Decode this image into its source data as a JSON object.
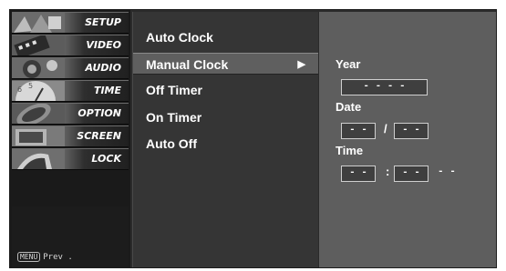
{
  "sidebar": {
    "items": [
      {
        "label": "SETUP"
      },
      {
        "label": "VIDEO"
      },
      {
        "label": "AUDIO"
      },
      {
        "label": "TIME"
      },
      {
        "label": "OPTION"
      },
      {
        "label": "SCREEN"
      },
      {
        "label": "LOCK"
      }
    ],
    "footer": {
      "key_label": "MENU",
      "text": "Prev ."
    }
  },
  "time_menu": {
    "items": [
      {
        "label": "Auto Clock"
      },
      {
        "label": "Manual Clock",
        "arrow": "▶"
      },
      {
        "label": "Off Timer"
      },
      {
        "label": "On Timer"
      },
      {
        "label": "Auto Off"
      }
    ],
    "selected_index": 1
  },
  "manual_clock": {
    "year_label": "Year",
    "year_value": "- - - -",
    "date_label": "Date",
    "date_month": "- -",
    "date_sep": "/",
    "date_day": "- -",
    "time_label": "Time",
    "time_hour": "- -",
    "time_sep": ":",
    "time_minute": "- -",
    "time_ampm": "- -"
  },
  "colors": {
    "frame": "#2b2b2b",
    "selected_row": "#5f5f5f",
    "panel": "#5e5e5e",
    "text": "#ffffff"
  }
}
